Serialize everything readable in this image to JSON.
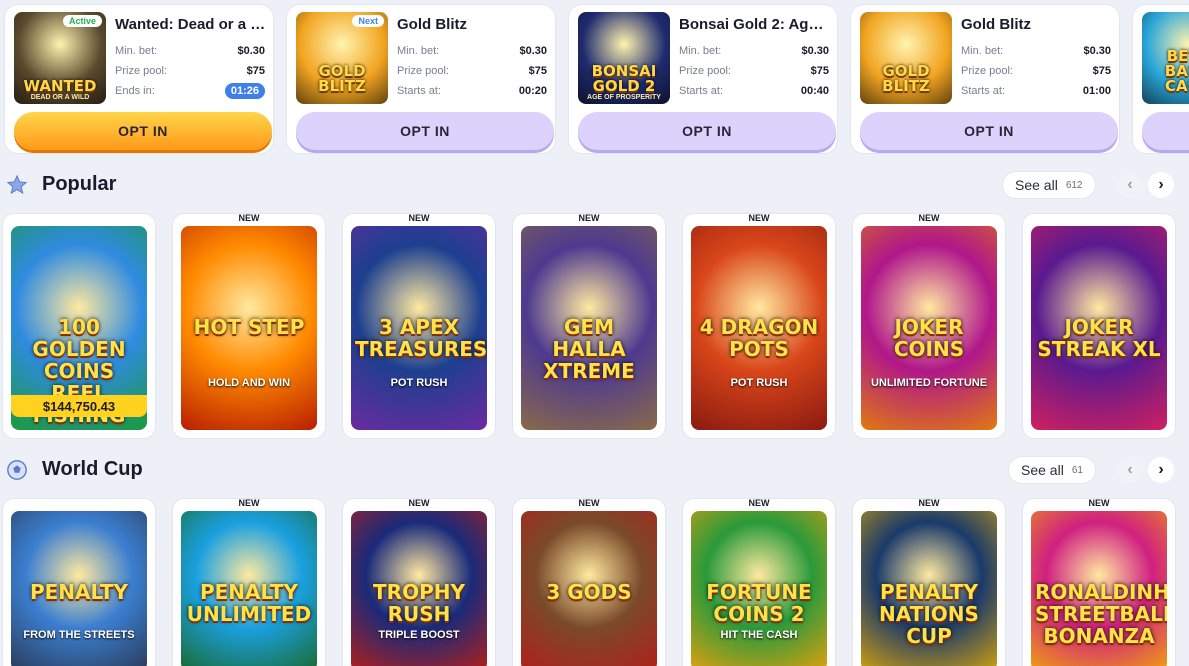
{
  "tournaments": [
    {
      "title": "Wanted: Dead or a W...",
      "badge": "Active",
      "badge_color": "#23b14d",
      "art": {
        "line1": "WANTED",
        "line2": "DEAD OR A WILD",
        "bg": "#5b4a2e"
      },
      "rows": [
        {
          "label": "Min. bet:",
          "value": "$0.30"
        },
        {
          "label": "Prize pool:",
          "value": "$75"
        },
        {
          "label": "Ends in:",
          "value": "01:26",
          "timer": true
        }
      ],
      "button": "OPT IN",
      "button_style": "orange"
    },
    {
      "title": "Gold Blitz",
      "badge": "Next",
      "badge_color": "#3f7fea",
      "art": {
        "line1": "GOLD BLITZ",
        "line2": "",
        "bg": "#f2a521"
      },
      "rows": [
        {
          "label": "Min. bet:",
          "value": "$0.30"
        },
        {
          "label": "Prize pool:",
          "value": "$75"
        },
        {
          "label": "Starts at:",
          "value": "00:20"
        }
      ],
      "button": "OPT IN",
      "button_style": "purple"
    },
    {
      "title": "Bonsai Gold 2: Age of ...",
      "badge": "",
      "badge_color": "",
      "art": {
        "line1": "BONSAI GOLD 2",
        "line2": "AGE OF PROSPERITY",
        "bg": "#1f2b6e"
      },
      "rows": [
        {
          "label": "Min. bet:",
          "value": "$0.30"
        },
        {
          "label": "Prize pool:",
          "value": "$75"
        },
        {
          "label": "Starts at:",
          "value": "00:40"
        }
      ],
      "button": "OPT IN",
      "button_style": "purple"
    },
    {
      "title": "Gold Blitz",
      "badge": "",
      "badge_color": "",
      "art": {
        "line1": "GOLD BLITZ",
        "line2": "",
        "bg": "#f2a521"
      },
      "rows": [
        {
          "label": "Min. bet:",
          "value": "$0.30"
        },
        {
          "label": "Prize pool:",
          "value": "$75"
        },
        {
          "label": "Starts at:",
          "value": "01:00"
        }
      ],
      "button": "OPT IN",
      "button_style": "purple"
    },
    {
      "title": "",
      "badge": "",
      "badge_color": "",
      "art": {
        "line1": "BETT BASH CASH",
        "line2": "",
        "bg": "#2aa6d9"
      },
      "rows": [],
      "button": "",
      "button_style": "purple"
    }
  ],
  "sections": [
    {
      "id": "popular",
      "title": "Popular",
      "icon": "star-icon",
      "see_all": "See all",
      "count": "612",
      "games": [
        {
          "title": "100 GOLDEN COINS REEL FISHING",
          "sub": "",
          "new": "",
          "jackpot": "$144,750.43",
          "c1": "#2f8be0",
          "c2": "#1a9a3a"
        },
        {
          "title": "HOT STEP",
          "sub": "HOLD AND WIN",
          "new": "NEW",
          "jackpot": "",
          "c1": "#ff8a00",
          "c2": "#b81e00"
        },
        {
          "title": "3 APEX TREASURES",
          "sub": "POT RUSH",
          "new": "NEW",
          "jackpot": "",
          "c1": "#1d3f8f",
          "c2": "#6a2ba0"
        },
        {
          "title": "GEM HALLA XTREME",
          "sub": "",
          "new": "NEW",
          "jackpot": "",
          "c1": "#4d3a8f",
          "c2": "#8a6a4a"
        },
        {
          "title": "4 DRAGON POTS",
          "sub": "POT RUSH",
          "new": "NEW",
          "jackpot": "",
          "c1": "#d9461a",
          "c2": "#8a1a10"
        },
        {
          "title": "JOKER COINS",
          "sub": "UNLIMITED FORTUNE",
          "new": "NEW",
          "jackpot": "",
          "c1": "#b0178a",
          "c2": "#e07a10"
        },
        {
          "title": "JOKER STREAK XL",
          "sub": "",
          "new": "",
          "jackpot": "",
          "c1": "#5a1a8f",
          "c2": "#d02060"
        }
      ]
    },
    {
      "id": "world-cup",
      "title": "World Cup",
      "icon": "soccer-ball-icon",
      "see_all": "See all",
      "count": "61",
      "games": [
        {
          "title": "PENALTY",
          "sub": "FROM THE STREETS",
          "new": "",
          "jackpot": "",
          "c1": "#3b7fd0",
          "c2": "#2a3b5a"
        },
        {
          "title": "PENALTY UNLIMITED",
          "sub": "",
          "new": "NEW",
          "jackpot": "",
          "c1": "#1aa0e0",
          "c2": "#1a6a30"
        },
        {
          "title": "TROPHY RUSH",
          "sub": "TRIPLE BOOST",
          "new": "NEW",
          "jackpot": "",
          "c1": "#1a2a7a",
          "c2": "#b0201a"
        },
        {
          "title": "3 GODS",
          "sub": "",
          "new": "NEW",
          "jackpot": "",
          "c1": "#7a4a2a",
          "c2": "#b0201a"
        },
        {
          "title": "FORTUNE COINS 2",
          "sub": "HIT THE CASH",
          "new": "NEW",
          "jackpot": "",
          "c1": "#2a9a3a",
          "c2": "#e0a010"
        },
        {
          "title": "PENALTY NATIONS CUP",
          "sub": "",
          "new": "NEW",
          "jackpot": "",
          "c1": "#1a3a6a",
          "c2": "#d0a010"
        },
        {
          "title": "RONALDINHO'S STREETBALL BONANZA",
          "sub": "",
          "new": "NEW",
          "jackpot": "",
          "c1": "#d02080",
          "c2": "#f0a010"
        }
      ]
    }
  ]
}
